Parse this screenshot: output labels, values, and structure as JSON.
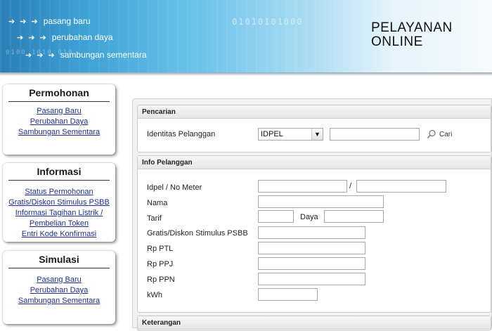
{
  "banner": {
    "links": [
      {
        "label": "pasang baru"
      },
      {
        "label": "perubahan daya"
      },
      {
        "label": "sambungan sementara"
      }
    ],
    "arrows": "➔ ➔ ➔",
    "title_line1": "PELAYANAN",
    "title_line2": "ONLINE",
    "binary": "01010101000",
    "binary2": "0100 1010 010"
  },
  "sidebar": {
    "permohonan": {
      "title": "Permohonan",
      "items": [
        "Pasang Baru",
        "Perubahan Daya",
        "Sambungan Sementara"
      ]
    },
    "informasi": {
      "title": "Informasi",
      "items": [
        "Status Permohonan",
        "Gratis/Diskon Stimulus PSBB",
        "Informasi Tagihan Listrik /",
        "Pembelian Token",
        "Entri Kode Konfirmasi"
      ]
    },
    "simulasi": {
      "title": "Simulasi",
      "items": [
        "Pasang Baru",
        "Perubahan Daya",
        "Sambungan Sementara"
      ]
    }
  },
  "pencarian": {
    "header": "Pencarian",
    "label": "Identitas Pelanggan",
    "select_value": "IDPEL",
    "search_value": "",
    "button_label": "Cari"
  },
  "info": {
    "header": "Info Pelanggan",
    "idpel_label": "Idpel / No Meter",
    "separator": "/",
    "nama_label": "Nama",
    "tarif_label": "Tarif",
    "daya_label": "Daya",
    "gratis_label": "Gratis/Diskon Stimulus PSBB",
    "ptl_label": "Rp PTL",
    "ppj_label": "Rp PPJ",
    "ppn_label": "Rp PPN",
    "kwh_label": "kWh"
  },
  "keterangan": {
    "header": "Keterangan"
  }
}
